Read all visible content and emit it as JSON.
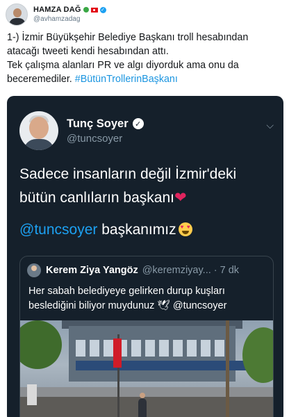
{
  "outer_tweet": {
    "display_name": "HAMZA DAĞ",
    "handle": "@avhamzadag",
    "icons": [
      "green-dot-icon",
      "turkey-flag-icon",
      "verified-badge-icon"
    ],
    "lines": [
      "1-) İzmir Büyükşehir Belediye Başkanı troll hesabından",
      "atacağı tweeti kendi hesabından attı.",
      "Tek çalışma alanları PR ve algı diyorduk ama onu da",
      "beceremediler."
    ],
    "hashtag": "#BütünTrollerinBaşkanı"
  },
  "embedded_tweet": {
    "display_name": "Tunç Soyer",
    "handle": "@tuncsoyer",
    "text_line1": "Sadece insanların değil İzmir'deki",
    "text_line2": "bütün canlıların başkanı",
    "heart": "❤",
    "mention": "@tuncsoyer",
    "after_mention": " başkanımız",
    "colors": {
      "background": "#15202b",
      "link": "#1da1f2",
      "secondary_text": "#8899a6"
    }
  },
  "quoted_tweet": {
    "display_name": "Kerem Ziya Yangöz",
    "handle": "@keremziyay...",
    "time": "· 7 dk",
    "line1": "Her sabah belediyeye gelirken durup kuşları",
    "line2_prefix": "beslediğini biliyor muydunuz",
    "dove": "🕊",
    "line2_mention": "@tuncsoyer"
  }
}
